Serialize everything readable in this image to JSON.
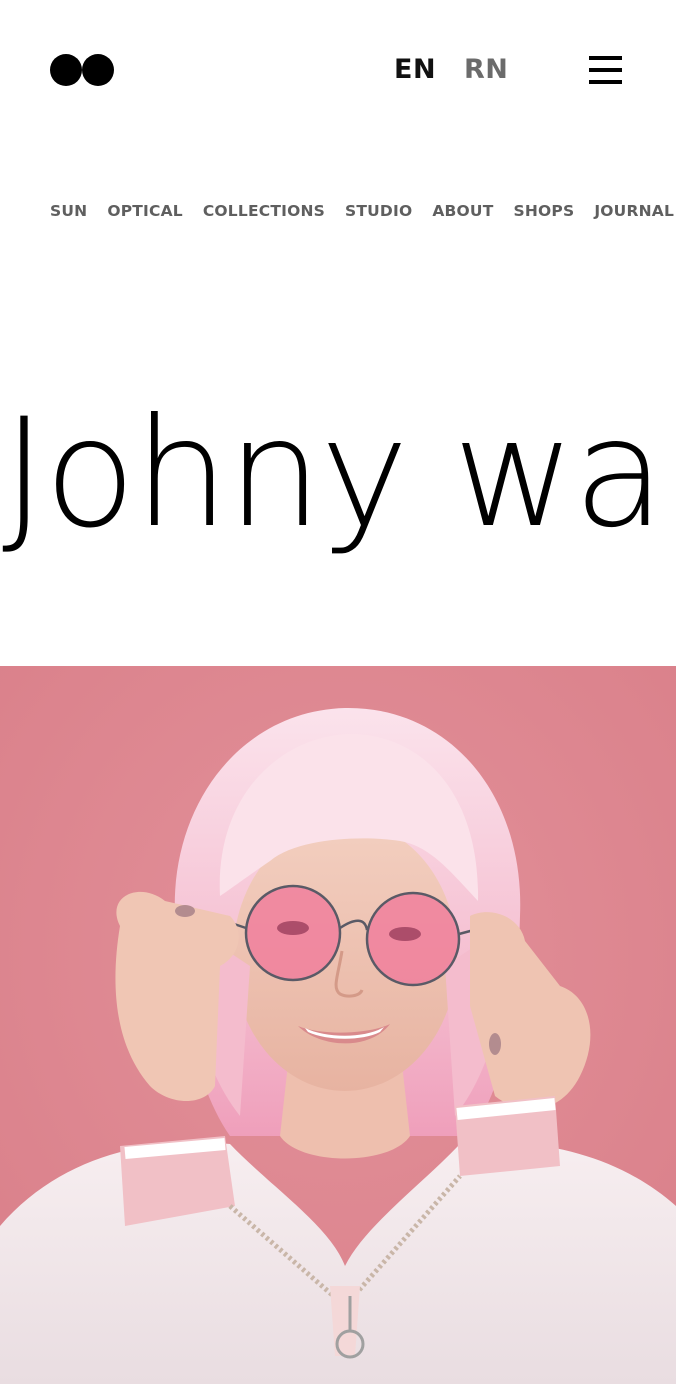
{
  "header": {
    "logo_name": "two-circles-logo",
    "languages": [
      {
        "label": "EN",
        "active": true
      },
      {
        "label": "RN",
        "active": false
      }
    ],
    "menu_icon": "hamburger-icon"
  },
  "nav": {
    "items": [
      "SUN",
      "OPTICAL",
      "COLLECTIONS",
      "STUDIO",
      "ABOUT",
      "SHOPS",
      "JOURNAL"
    ]
  },
  "hero": {
    "headline": "Johny wa",
    "image": {
      "subject": "woman with pink bob hair wearing round pink-tinted glasses",
      "background_color": "#df8690"
    }
  },
  "colors": {
    "text": "#000000",
    "nav_text": "#5f5f5f",
    "lang_inactive": "#6b6b6b",
    "hero_background": "#df8690",
    "hair": "#f6c8d6",
    "lens": "#f07f9c"
  }
}
